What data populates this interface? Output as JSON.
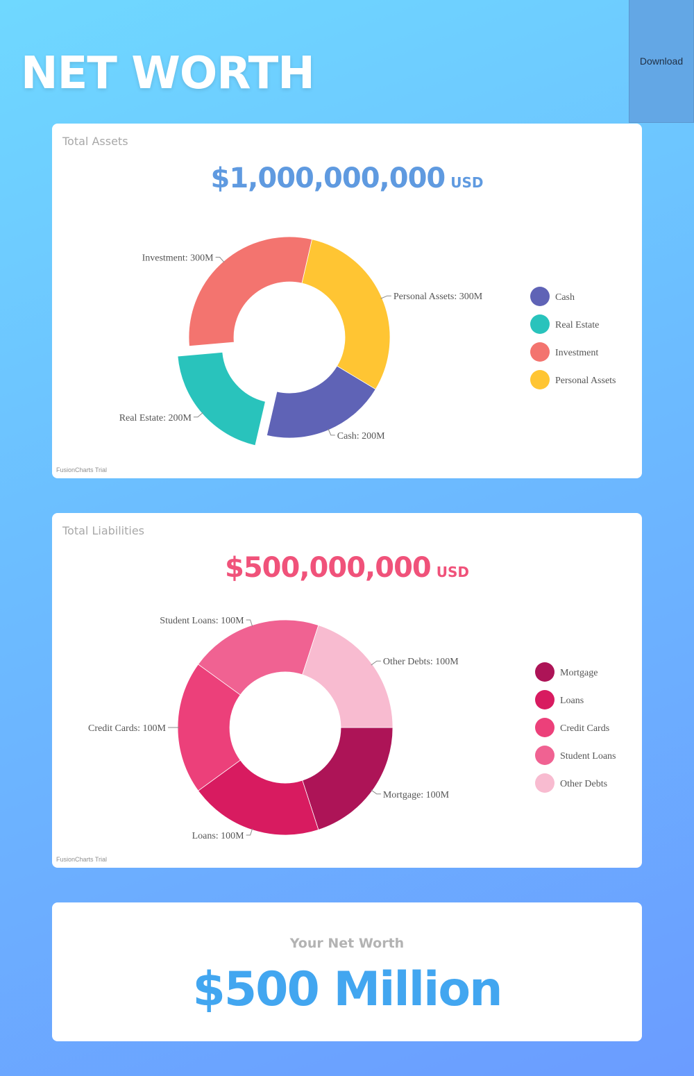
{
  "page_title": "NET WORTH",
  "download_label": "Download",
  "assets": {
    "caption": "Total Assets",
    "amount": "$1,000,000,000",
    "currency": "USD",
    "trial_mark": "FusionCharts Trial",
    "chart_data": {
      "type": "pie",
      "variant": "doughnut",
      "categories": [
        "Cash",
        "Real Estate",
        "Investment",
        "Personal Assets"
      ],
      "values": [
        200,
        200,
        300,
        300
      ],
      "data_labels": [
        "Cash: 200M",
        "Real Estate: 200M",
        "Investment: 300M",
        "Personal Assets: 300M"
      ],
      "colors": [
        "#5f63b6",
        "#29c3bc",
        "#f3746f",
        "#ffc533"
      ],
      "exploded": [
        "Real Estate"
      ],
      "legend": {
        "position": "right",
        "entries": [
          "Cash",
          "Real Estate",
          "Investment",
          "Personal Assets"
        ]
      }
    }
  },
  "liabilities": {
    "caption": "Total Liabilities",
    "amount": "$500,000,000",
    "currency": "USD",
    "trial_mark": "FusionCharts Trial",
    "chart_data": {
      "type": "pie",
      "variant": "doughnut",
      "categories": [
        "Mortgage",
        "Loans",
        "Credit Cards",
        "Student Loans",
        "Other Debts"
      ],
      "values": [
        100,
        100,
        100,
        100,
        100
      ],
      "data_labels": [
        "Mortgage: 100M",
        "Loans: 100M",
        "Credit Cards: 100M",
        "Student Loans: 100M",
        "Other Debts: 100M"
      ],
      "colors": [
        "#ad1457",
        "#d81b60",
        "#ec407a",
        "#f06292",
        "#f8bbd0"
      ],
      "exploded": [],
      "legend": {
        "position": "right",
        "entries": [
          "Mortgage",
          "Loans",
          "Credit Cards",
          "Student Loans",
          "Other Debts"
        ]
      }
    }
  },
  "net_worth": {
    "caption": "Your Net Worth",
    "value": "$500 Million"
  }
}
